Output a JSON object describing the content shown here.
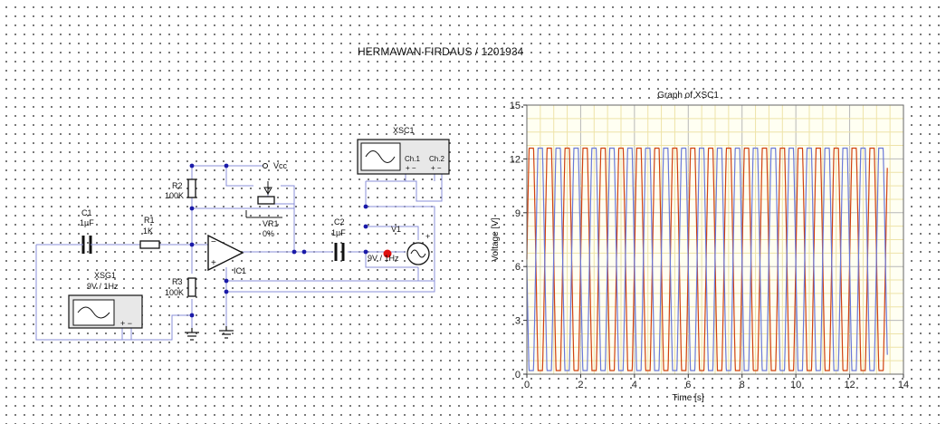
{
  "title": "HERMAWAN FIRDAUS / 1201934",
  "components": {
    "c1": {
      "ref": "C1",
      "value": "1µF"
    },
    "r1": {
      "ref": "R1",
      "value": "1K"
    },
    "r2": {
      "ref": "R2",
      "value": "100K"
    },
    "r3": {
      "ref": "R3",
      "value": "100K"
    },
    "vr1": {
      "ref": "VR1",
      "value": "0%"
    },
    "c2": {
      "ref": "C2",
      "value": "1µF"
    },
    "ic1": {
      "ref": "IC1"
    },
    "vcc": {
      "label": "Vcc"
    },
    "xsg1": {
      "ref": "XSG1",
      "value": "9V / 1Hz",
      "terminals": "+ −"
    },
    "xsc1": {
      "ref": "XSC1",
      "ch1": "Ch.1",
      "ch2": "Ch.2",
      "terminals": "+ −"
    },
    "v1": {
      "ref": "V1",
      "value": "9V / 1Hz"
    }
  },
  "chart_data": {
    "type": "line",
    "title": "Graph of XSC1",
    "xlabel": "Time [s]",
    "ylabel": "Voltage [V]",
    "xlim": [
      0,
      14
    ],
    "ylim": [
      0,
      15
    ],
    "xticks": [
      0,
      2,
      4,
      6,
      8,
      10,
      12,
      14
    ],
    "yticks": [
      0,
      3,
      6,
      9,
      12,
      15
    ],
    "grid": true,
    "series": [
      {
        "color": "#d04010",
        "frequency_hz": 1.5,
        "min": 0.2,
        "max": 12.6,
        "phase_s": 0.0,
        "t_end": 13.4
      },
      {
        "color": "#6a78d8",
        "frequency_hz": 1.5,
        "min": 0.2,
        "max": 12.6,
        "phase_s": 0.33,
        "t_end": 13.4
      }
    ]
  }
}
